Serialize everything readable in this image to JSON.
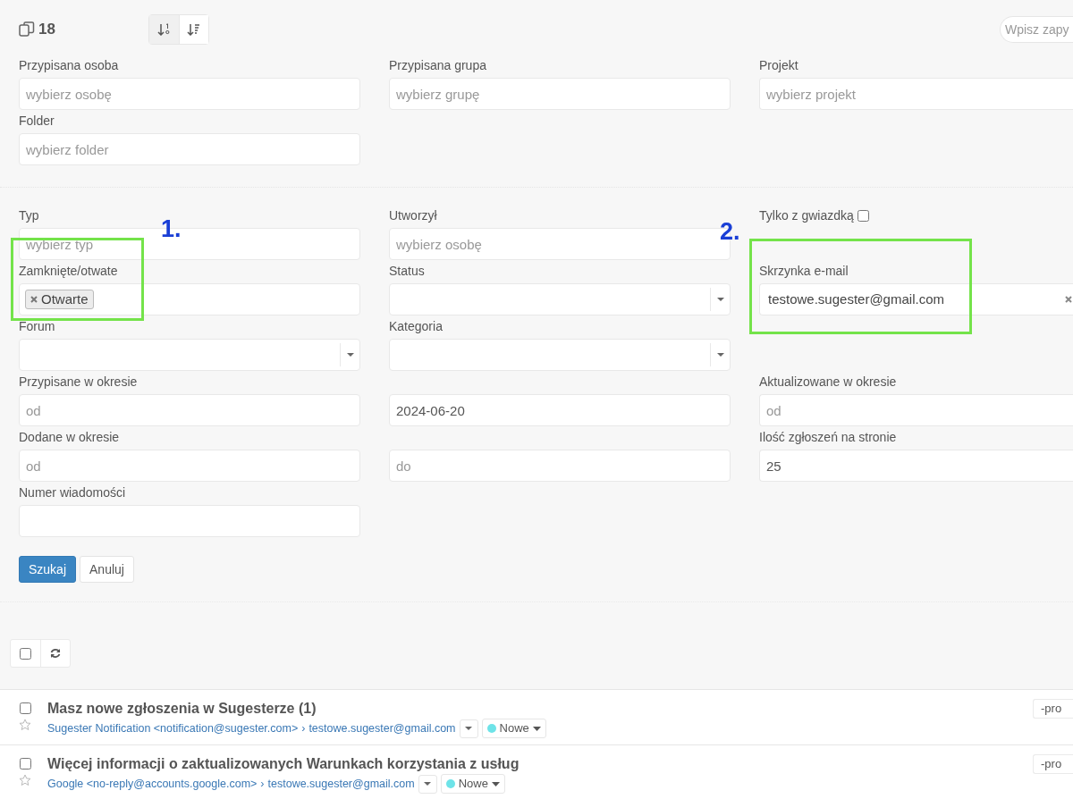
{
  "toolbar": {
    "count": "18",
    "sort_buttons": [
      {
        "kind": "numeric",
        "selected": true
      },
      {
        "kind": "list",
        "selected": false
      }
    ],
    "search": {
      "placeholder": "Wpisz zapy"
    }
  },
  "filter_sections": [
    [
      [
        {
          "kind": "text",
          "label": "Przypisana osoba",
          "placeholder": "wybierz osobę"
        },
        {
          "kind": "text",
          "label": "Przypisana grupa",
          "placeholder": "wybierz grupę"
        },
        {
          "kind": "text",
          "label": "Projekt",
          "placeholder": "wybierz projekt"
        }
      ],
      [
        {
          "kind": "text",
          "label": "Folder",
          "placeholder": "wybierz folder"
        },
        {
          "kind": "empty"
        },
        {
          "kind": "empty"
        }
      ]
    ],
    [
      [
        {
          "kind": "text",
          "label": "Typ",
          "placeholder": "wybierz typ"
        },
        {
          "kind": "text",
          "label": "Utworzył",
          "placeholder": "wybierz osobę"
        },
        {
          "kind": "checkbox",
          "label": "Tylko z gwiazdką",
          "checked": false
        }
      ],
      [
        {
          "kind": "tags",
          "label": "Zamknięte/otwate",
          "tags": [
            "Otwarte"
          ]
        },
        {
          "kind": "select",
          "label": "Status"
        },
        {
          "kind": "clearable",
          "label": "Skrzynka e-mail",
          "value": "testowe.sugester@gmail.com"
        }
      ],
      [
        {
          "kind": "select",
          "label": "Forum"
        },
        {
          "kind": "select",
          "label": "Kategoria"
        },
        {
          "kind": "empty"
        }
      ],
      [
        {
          "kind": "text",
          "label": "Przypisane w okresie",
          "placeholder": "od"
        },
        {
          "kind": "text",
          "value": "2024-06-20"
        },
        {
          "kind": "text",
          "label": "Aktualizowane w okresie",
          "placeholder": "od"
        }
      ],
      [
        {
          "kind": "text",
          "label": "Dodane w okresie",
          "placeholder": "od"
        },
        {
          "kind": "text",
          "placeholder": "do"
        },
        {
          "kind": "text",
          "label": "Ilość zgłoszeń na stronie",
          "value": "25"
        }
      ],
      [
        {
          "kind": "text",
          "label": "Numer wiadomości"
        },
        {
          "kind": "empty"
        },
        {
          "kind": "empty"
        }
      ]
    ]
  ],
  "buttons": [
    {
      "label": "Szukaj",
      "kind": "primary"
    },
    {
      "label": "Anuluj",
      "kind": "secondary"
    }
  ],
  "list_toolbar": {
    "select_all_checked": false
  },
  "emails": [
    {
      "checked": false,
      "starred": false,
      "subject": "Masz nowe zgłoszenia w Sugesterze (1)",
      "sender": "Sugester Notification <notification@sugester.com>",
      "separator": "›",
      "recipient": "testowe.sugester@gmail.com",
      "status": {
        "label": "Nowe",
        "color": "#6ee3e8"
      },
      "side_button": "-pro"
    },
    {
      "checked": false,
      "starred": false,
      "subject": "Więcej informacji o zaktualizowanych Warunkach korzystania z usług",
      "sender": "Google <no-reply@accounts.google.com>",
      "separator": "›",
      "recipient": "testowe.sugester@gmail.com",
      "status": {
        "label": "Nowe",
        "color": "#6ee3e8"
      },
      "side_button": "-pro"
    }
  ],
  "annotations": [
    {
      "label": "1."
    },
    {
      "label": "2."
    }
  ]
}
